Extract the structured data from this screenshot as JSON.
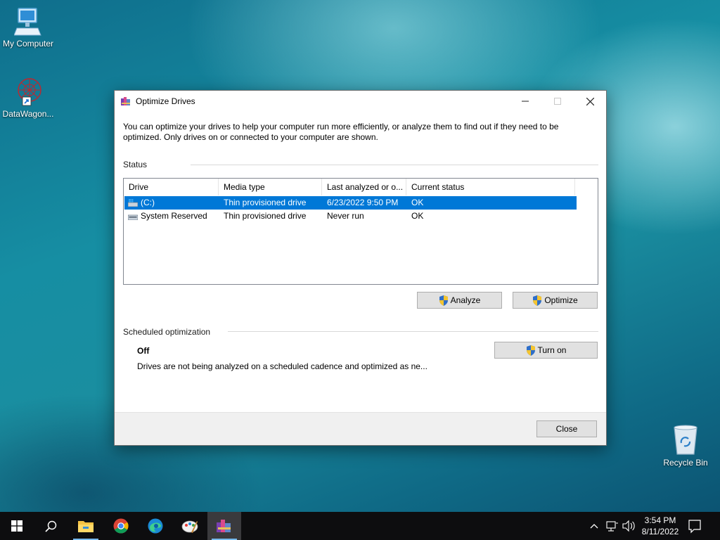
{
  "desktop": {
    "icons": [
      {
        "label": "My Computer",
        "icon": "monitor-icon"
      },
      {
        "label": "DataWagon...",
        "icon": "network-shortcut-icon"
      },
      {
        "label": "Recycle Bin",
        "icon": "recycle-bin-icon"
      }
    ]
  },
  "window": {
    "title": "Optimize Drives",
    "intro": "You can optimize your drives to help your computer run more efficiently, or analyze them to find out if they need to be optimized. Only drives on or connected to your computer are shown.",
    "status_label": "Status",
    "columns": [
      "Drive",
      "Media type",
      "Last analyzed or o...",
      "Current status"
    ],
    "drives": [
      {
        "drive": "(C:)",
        "media": "Thin provisioned drive",
        "last": "6/23/2022 9:50 PM",
        "status": "OK",
        "selected": true
      },
      {
        "drive": "System Reserved",
        "media": "Thin provisioned drive",
        "last": "Never run",
        "status": "OK",
        "selected": false
      }
    ],
    "analyze_label": "Analyze",
    "optimize_label": "Optimize",
    "scheduled_label": "Scheduled optimization",
    "schedule_state": "Off",
    "schedule_desc": "Drives are not being analyzed on a scheduled cadence and optimized as ne...",
    "turn_on_label": "Turn on",
    "close_label": "Close"
  },
  "taskbar": {
    "time": "3:54 PM",
    "date": "8/11/2022",
    "apps": [
      "start-icon",
      "search-icon",
      "file-explorer-icon",
      "chrome-icon",
      "edge-icon",
      "paint-icon",
      "defrag-icon"
    ]
  },
  "colors": {
    "selection": "#0078d7",
    "accent": "#0078d7"
  }
}
